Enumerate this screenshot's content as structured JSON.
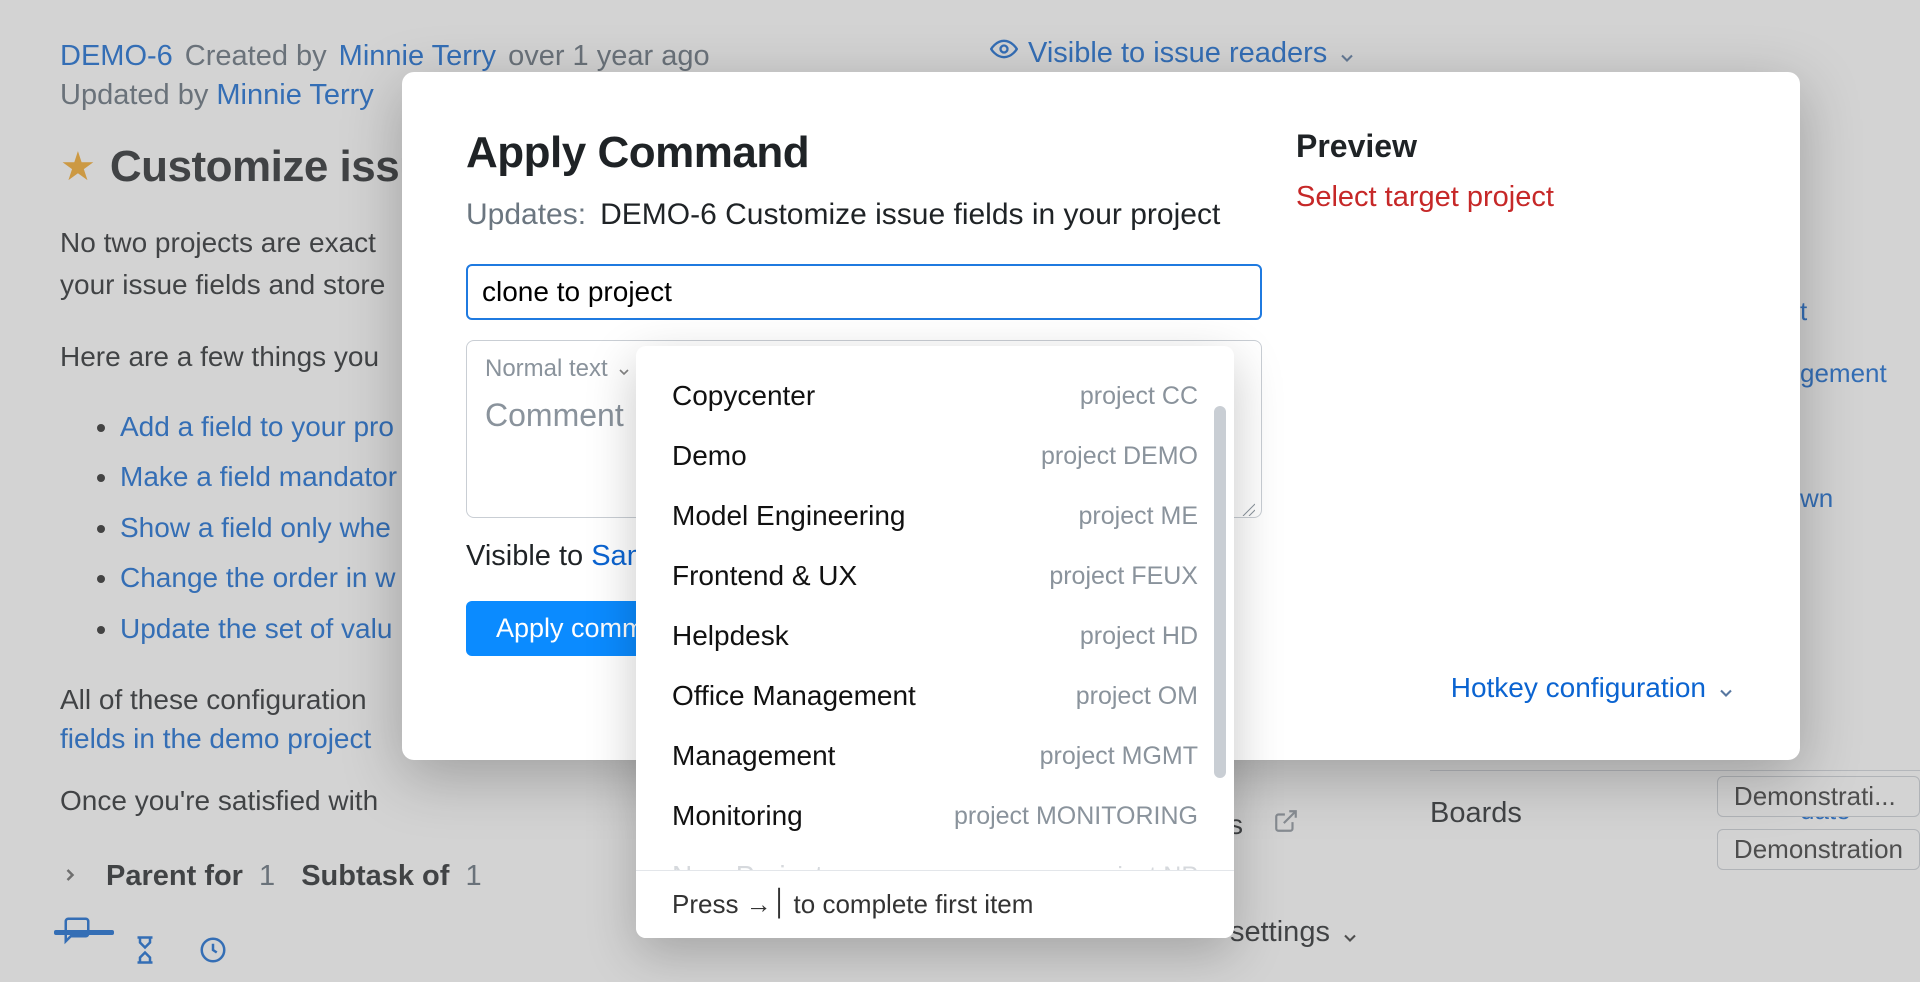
{
  "header": {
    "issueId": "DEMO-6",
    "createdByLabel": "Created by",
    "createdByUser": "Minnie Terry",
    "createdWhen": "over 1 year ago",
    "updatedByLabel": "Updated by",
    "updatedByUser": "Minnie Terry",
    "visibilityLabel": "Visible to issue readers"
  },
  "issue": {
    "title": "Customize issu",
    "descLine1": "No two projects are exact",
    "descLine2": "your issue fields and store",
    "descLine3": "Here are a few things you",
    "bullets": [
      "Add a field to your pro",
      "Make a field mandator",
      "Show a field only whe",
      "Change the order in w",
      "Update the set of valu"
    ],
    "paraAll": "All of these configuration",
    "paraFields": "fields in the demo project",
    "paraOnce": "Once you're satisfied with"
  },
  "relations": {
    "parentLabel": "Parent for",
    "parentCount": "1",
    "subtaskLabel": "Subtask of",
    "subtaskCount": "1"
  },
  "sidebarHints": {
    "a": "t",
    "b": "gement",
    "c": "wn",
    "d": "date"
  },
  "boards": {
    "label": "Boards",
    "chip1": "Demonstrati...",
    "chip2": "Demonstration"
  },
  "issueLinks": {
    "label": "ks"
  },
  "settings": {
    "label": "settings"
  },
  "modal": {
    "title": "Apply Command",
    "updatesLabel": "Updates:",
    "updatesTarget": "DEMO-6 Customize issue fields in your project",
    "commandValue": "clone to project",
    "normalText": "Normal text",
    "commentPlaceholder": "Comment",
    "visibleToLabel": "Visible to",
    "visibleToValue": "Sam",
    "applyButton": "Apply comma",
    "previewHeading": "Preview",
    "previewMessage": "Select target project",
    "hotkeyLabel": "Hotkey configuration"
  },
  "dropdown": {
    "items": [
      {
        "name": "Copycenter",
        "meta": "project CC"
      },
      {
        "name": "Demo",
        "meta": "project DEMO"
      },
      {
        "name": "Model Engineering",
        "meta": "project ME"
      },
      {
        "name": "Frontend & UX",
        "meta": "project FEUX"
      },
      {
        "name": "Helpdesk",
        "meta": "project HD"
      },
      {
        "name": "Office Management",
        "meta": "project OM"
      },
      {
        "name": "Management",
        "meta": "project MGMT"
      },
      {
        "name": "Monitoring",
        "meta": "project MONITORING"
      }
    ],
    "fadedItem": {
      "name": "New Project",
      "meta": "project NP"
    },
    "footerHint": "Press →׀ to complete first item"
  }
}
